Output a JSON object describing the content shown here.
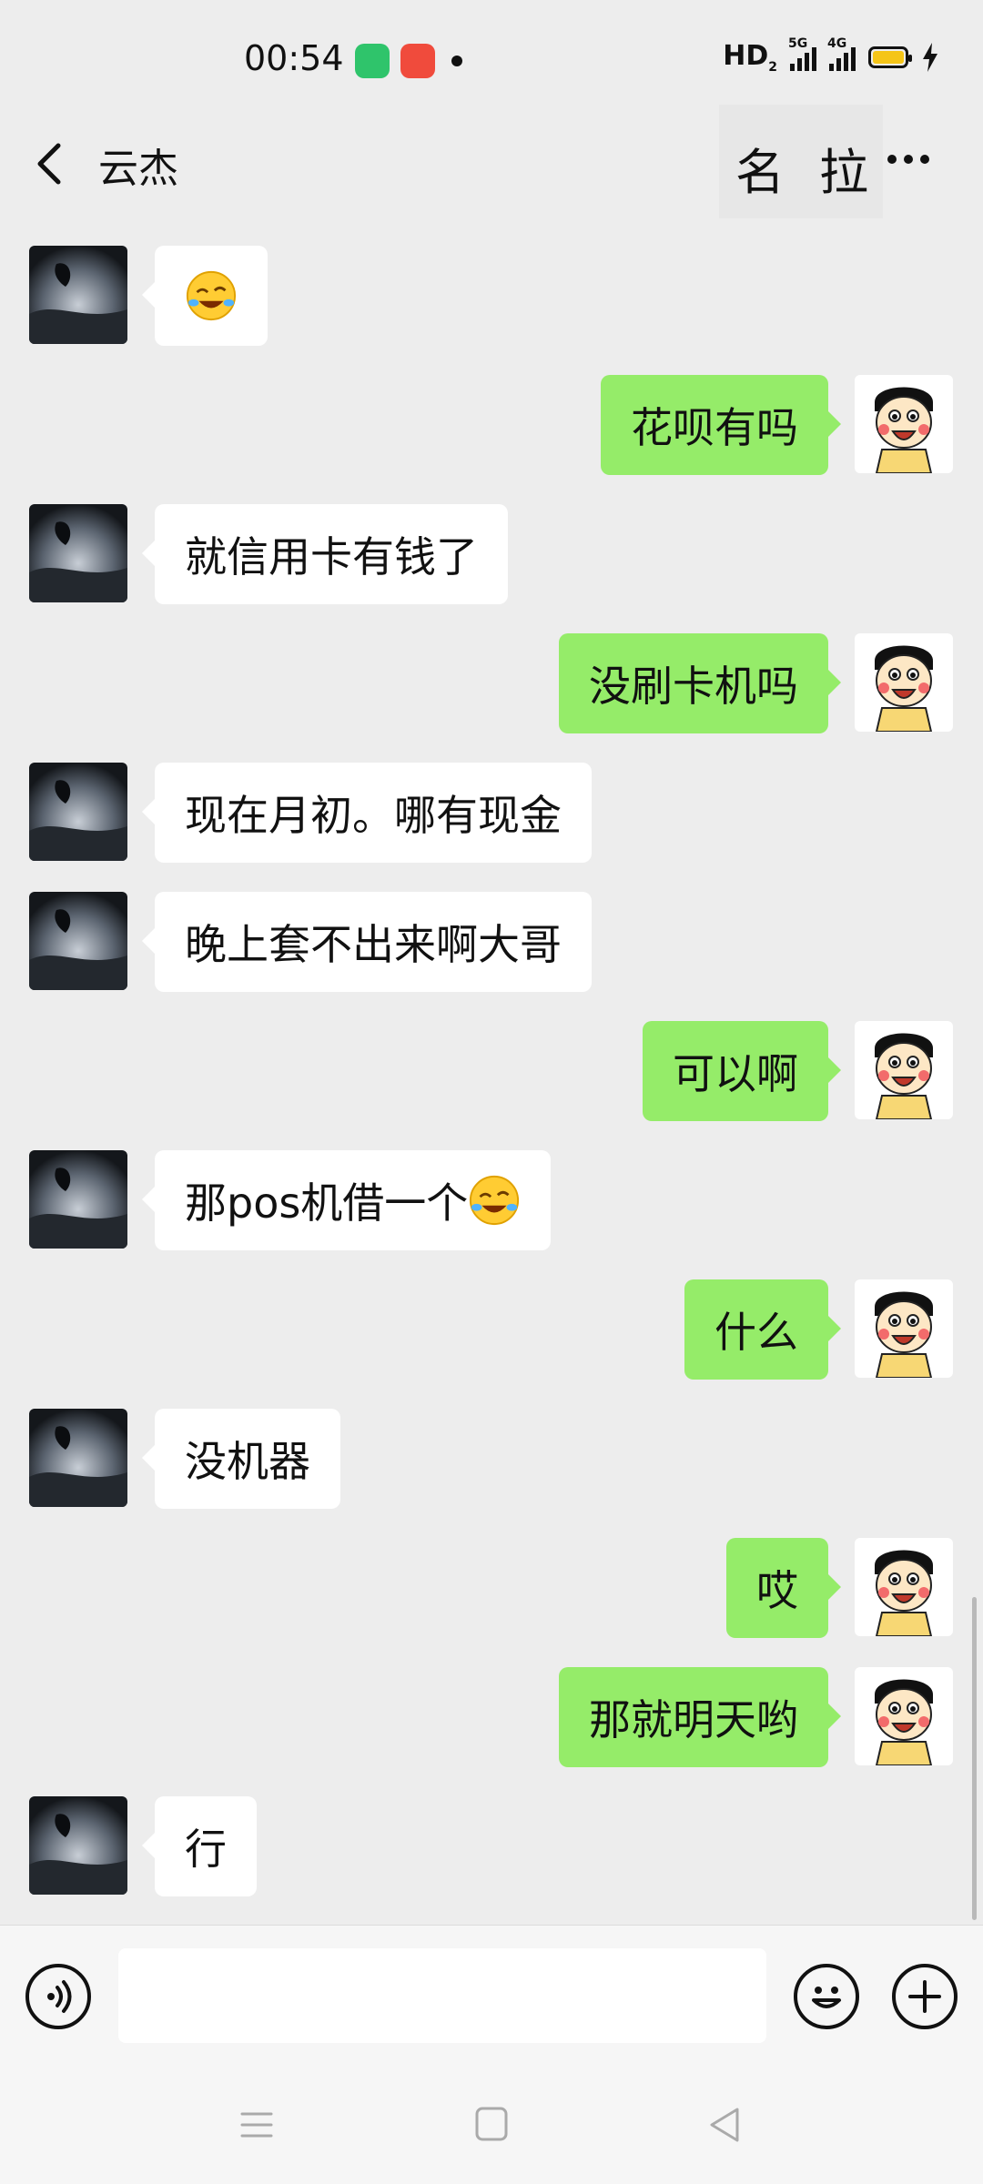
{
  "status_bar": {
    "time": "00:54",
    "hd_label": "HD",
    "hd_sub": "2",
    "network_5g": "5G",
    "network_4g": "4G",
    "battery_color": "#f5c518"
  },
  "header": {
    "title": "云杰",
    "button_1": "名",
    "button_2": "拉",
    "back_icon": "chevron-left-icon",
    "more_icon": "more-dots-icon"
  },
  "messages": [
    {
      "side": "left",
      "text": "",
      "emoji": "rolling-laughing-emoji"
    },
    {
      "side": "right",
      "text": "花呗有吗"
    },
    {
      "side": "left",
      "text": "就信用卡有钱了"
    },
    {
      "side": "right",
      "text": "没刷卡机吗"
    },
    {
      "side": "left",
      "text": "现在月初。哪有现金"
    },
    {
      "side": "left",
      "text": "晚上套不出来啊大哥"
    },
    {
      "side": "right",
      "text": "可以啊"
    },
    {
      "side": "left",
      "text": "那pos机借一个",
      "emoji": "rolling-laughing-emoji"
    },
    {
      "side": "right",
      "text": "什么"
    },
    {
      "side": "left",
      "text": "没机器"
    },
    {
      "side": "right",
      "text": "哎"
    },
    {
      "side": "right",
      "text": "那就明天哟"
    },
    {
      "side": "left",
      "text": "行"
    }
  ],
  "colors": {
    "background": "#ededed",
    "sent_bubble": "#95ec69",
    "received_bubble": "#ffffff"
  },
  "input_bar": {
    "voice_icon": "voice-icon",
    "emoji_icon": "smiley-icon",
    "plus_icon": "plus-icon",
    "value": ""
  },
  "nav_bar": {
    "icons": [
      "menu-icon",
      "home-square-icon",
      "back-triangle-icon"
    ]
  }
}
